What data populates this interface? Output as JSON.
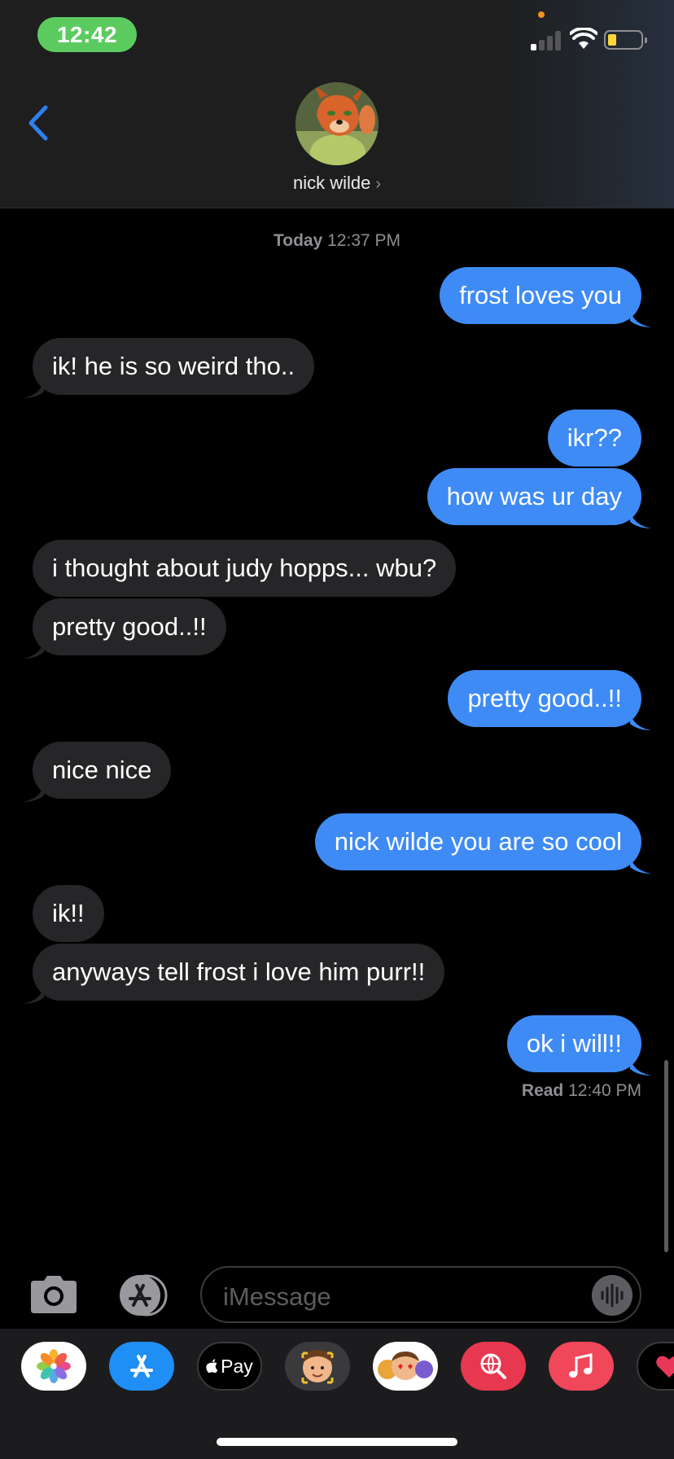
{
  "status_bar": {
    "time": "12:42"
  },
  "header": {
    "contact_name": "nick wilde",
    "chevron": "›",
    "back_icon": "chevron-left-icon"
  },
  "conversation": {
    "timestamp_day": "Today",
    "timestamp_time": "12:37 PM",
    "messages": [
      {
        "from": "me",
        "text": "frost loves you"
      },
      {
        "from": "them",
        "text": "ik! he is so weird tho.."
      },
      {
        "from": "me",
        "text": "ikr??"
      },
      {
        "from": "me",
        "text": "how was ur day"
      },
      {
        "from": "them",
        "text": "i thought about judy hopps... wbu?"
      },
      {
        "from": "them",
        "text": "pretty good..!!"
      },
      {
        "from": "me",
        "text": "pretty good..!!"
      },
      {
        "from": "them",
        "text": "nice nice"
      },
      {
        "from": "me",
        "text": "nick wilde you are so cool"
      },
      {
        "from": "them",
        "text": "ik!!"
      },
      {
        "from": "them",
        "text": "anyways tell frost i love him purr!!"
      },
      {
        "from": "me",
        "text": "ok i will!!"
      }
    ],
    "read_label": "Read",
    "read_time": "12:40 PM"
  },
  "composer": {
    "placeholder": "iMessage"
  },
  "app_drawer": {
    "apple_pay_label": "Pay",
    "apps": [
      "photos-icon",
      "app-store-icon",
      "apple-pay-icon",
      "memoji-icon",
      "animoji-stickers-icon",
      "web-search-icon",
      "music-icon",
      "digital-touch-icon"
    ]
  },
  "colors": {
    "outgoing_bubble": "#3e8bf6",
    "incoming_bubble": "#262628",
    "status_time_pill": "#5ccb5f",
    "accent": "#2f80ed"
  }
}
